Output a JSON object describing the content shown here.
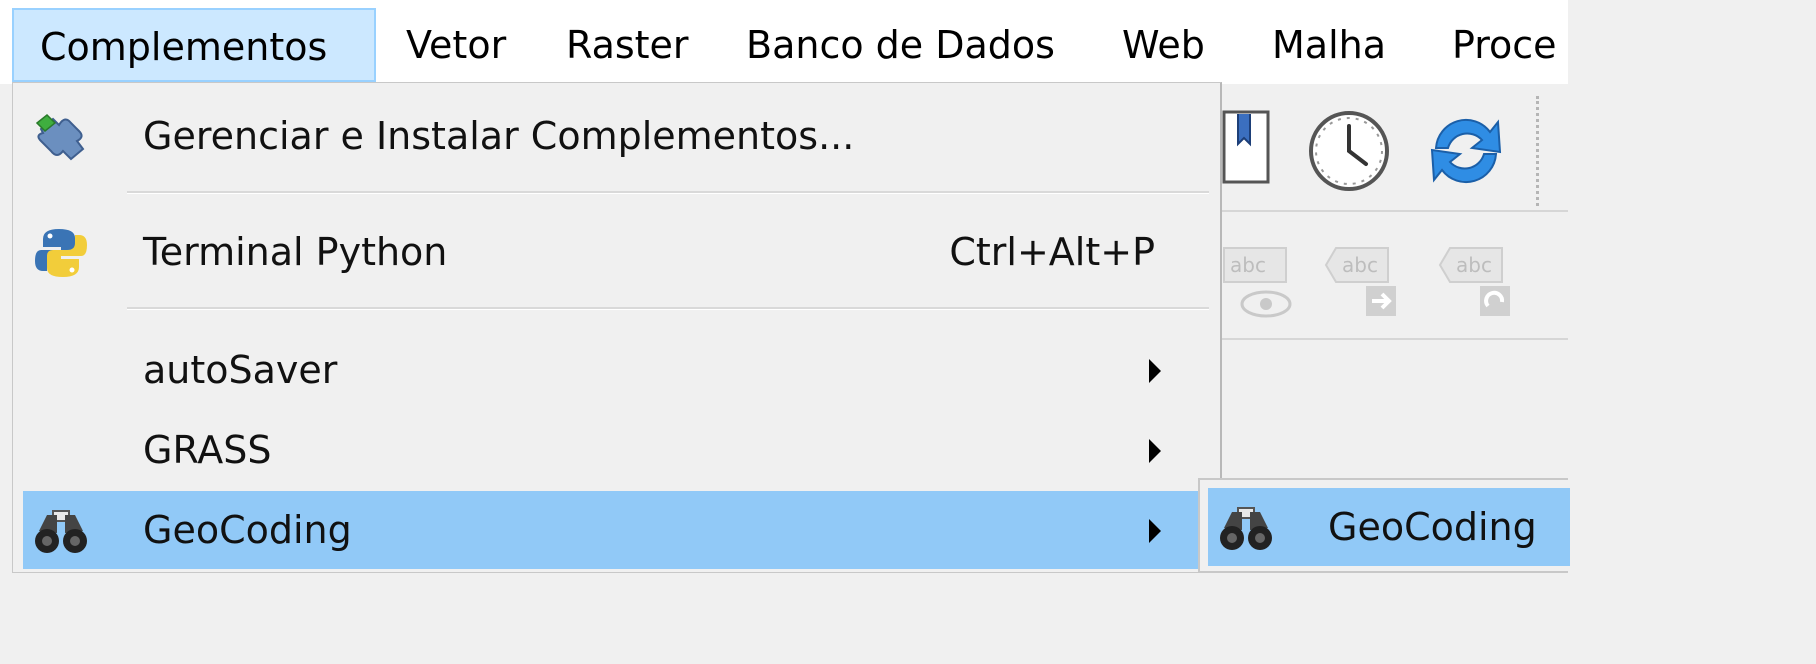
{
  "menubar": {
    "items": [
      "Complementos",
      "Vetor",
      "Raster",
      "Banco de Dados",
      "Web",
      "Malha",
      "Proce"
    ]
  },
  "menu": {
    "manage_plugins": {
      "label": "Gerenciar e Instalar Complementos...",
      "icon": "plugin-puzzle-icon"
    },
    "python_console": {
      "label": "Terminal Python",
      "shortcut": "Ctrl+Alt+P",
      "icon": "python-icon"
    },
    "autosaver": {
      "label": "autoSaver"
    },
    "grass": {
      "label": "GRASS"
    },
    "geocoding": {
      "label": "GeoCoding",
      "icon": "binoculars-icon"
    }
  },
  "submenu": {
    "geocoding": {
      "label": "GeoCoding",
      "icon": "binoculars-icon"
    }
  },
  "colors": {
    "highlight": "#91c9f7",
    "active_menu": "#cce8ff",
    "menu_bg": "#f0f0f0"
  }
}
